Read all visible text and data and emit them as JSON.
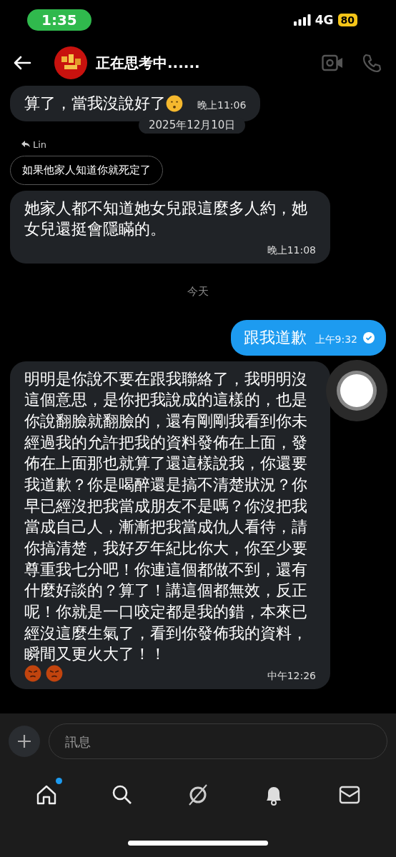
{
  "status_bar": {
    "time": "1:35",
    "network": "4G",
    "battery": "80"
  },
  "header": {
    "title": "正在思考中......"
  },
  "messages": [
    {
      "kind": "received",
      "text": "算了，當我沒說好了",
      "emojis": [
        {
          "kind": "shush"
        }
      ],
      "time": "晚上11:06"
    },
    {
      "kind": "date",
      "text": "2025年12月10日"
    },
    {
      "kind": "reply",
      "author": "Lin",
      "quote": "如果他家人知道你就死定了"
    },
    {
      "kind": "received",
      "text": "她家人都不知道她女兒跟這麼多人約，她女兒還挺會隱瞞的。",
      "time": "晚上11:08"
    },
    {
      "kind": "day",
      "text": "今天"
    },
    {
      "kind": "sent",
      "text": "跟我道歉",
      "time": "上午9:32",
      "read": true
    },
    {
      "kind": "received",
      "text": "明明是你說不要在跟我聯絡了，我明明沒這個意思，是你把我說成的這樣的，也是你說翻臉就翻臉的，還有剛剛我看到你未經過我的允許把我的資料發佈在上面，發佈在上面那也就算了還這樣說我，你還要我道歉？你是喝醉還是搞不清楚狀況？你早已經沒把我當成朋友不是嗎？你沒把我當成自己人，漸漸把我當成仇人看待，請你搞清楚，我好歹年紀比你大，你至少要尊重我七分吧！你連這個都做不到，還有什麼好談的？算了！講這個都無效，反正呢！你就是一口咬定都是我的錯，本來已經沒這麼生氣了，看到你發佈我的資料，瞬間又更火大了！！",
      "emojis": [
        {
          "kind": "angry"
        },
        {
          "kind": "angry"
        }
      ],
      "time": "中午12:26"
    }
  ],
  "composer": {
    "placeholder": "訊息"
  },
  "tab_bar": [
    {
      "kind": "home",
      "badge": true
    },
    {
      "kind": "search",
      "badge": false
    },
    {
      "kind": "explore",
      "badge": false
    },
    {
      "kind": "bell",
      "badge": false
    },
    {
      "kind": "mail",
      "badge": false
    }
  ]
}
